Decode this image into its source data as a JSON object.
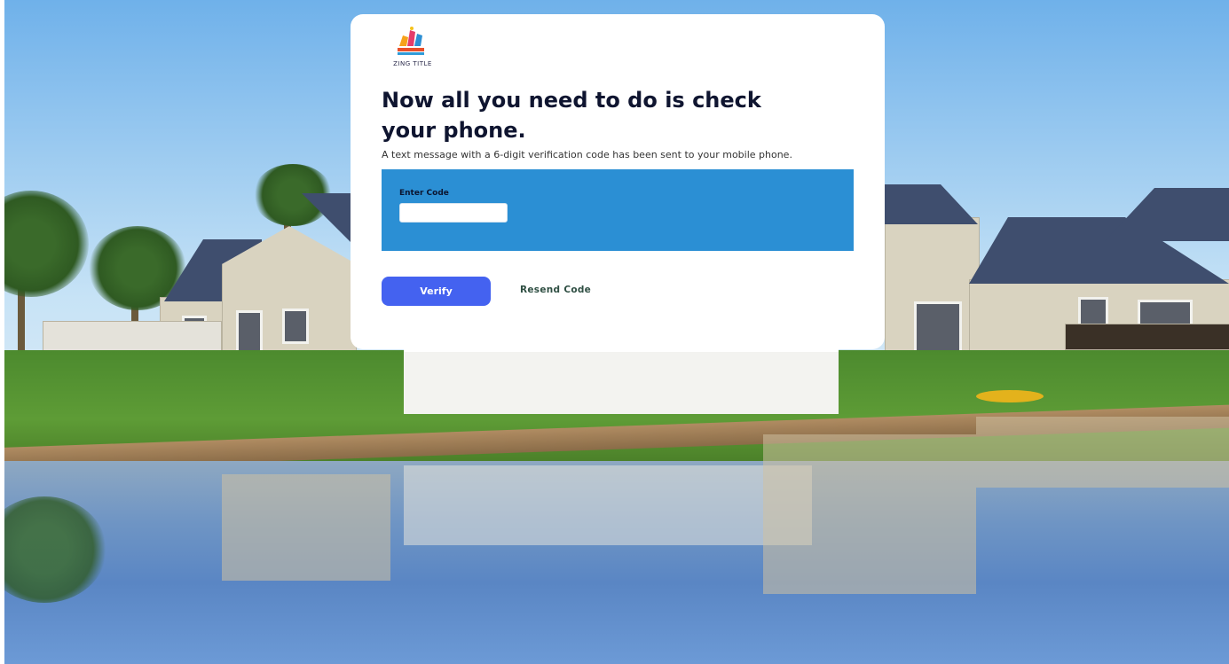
{
  "brand": {
    "logo_text": "ZING TITLE"
  },
  "page": {
    "headline": "Now all you need to do is check your phone.",
    "subtext": "A text message with a 6-digit verification code has been sent to your mobile phone."
  },
  "code_form": {
    "label": "Enter Code",
    "value": "",
    "placeholder": ""
  },
  "actions": {
    "verify_label": "Verify",
    "resend_label": "Resend Code"
  },
  "colors": {
    "panel": "#2b8fd4",
    "button": "#4462f0",
    "link": "#2f4f43",
    "headline": "#0f1530"
  }
}
